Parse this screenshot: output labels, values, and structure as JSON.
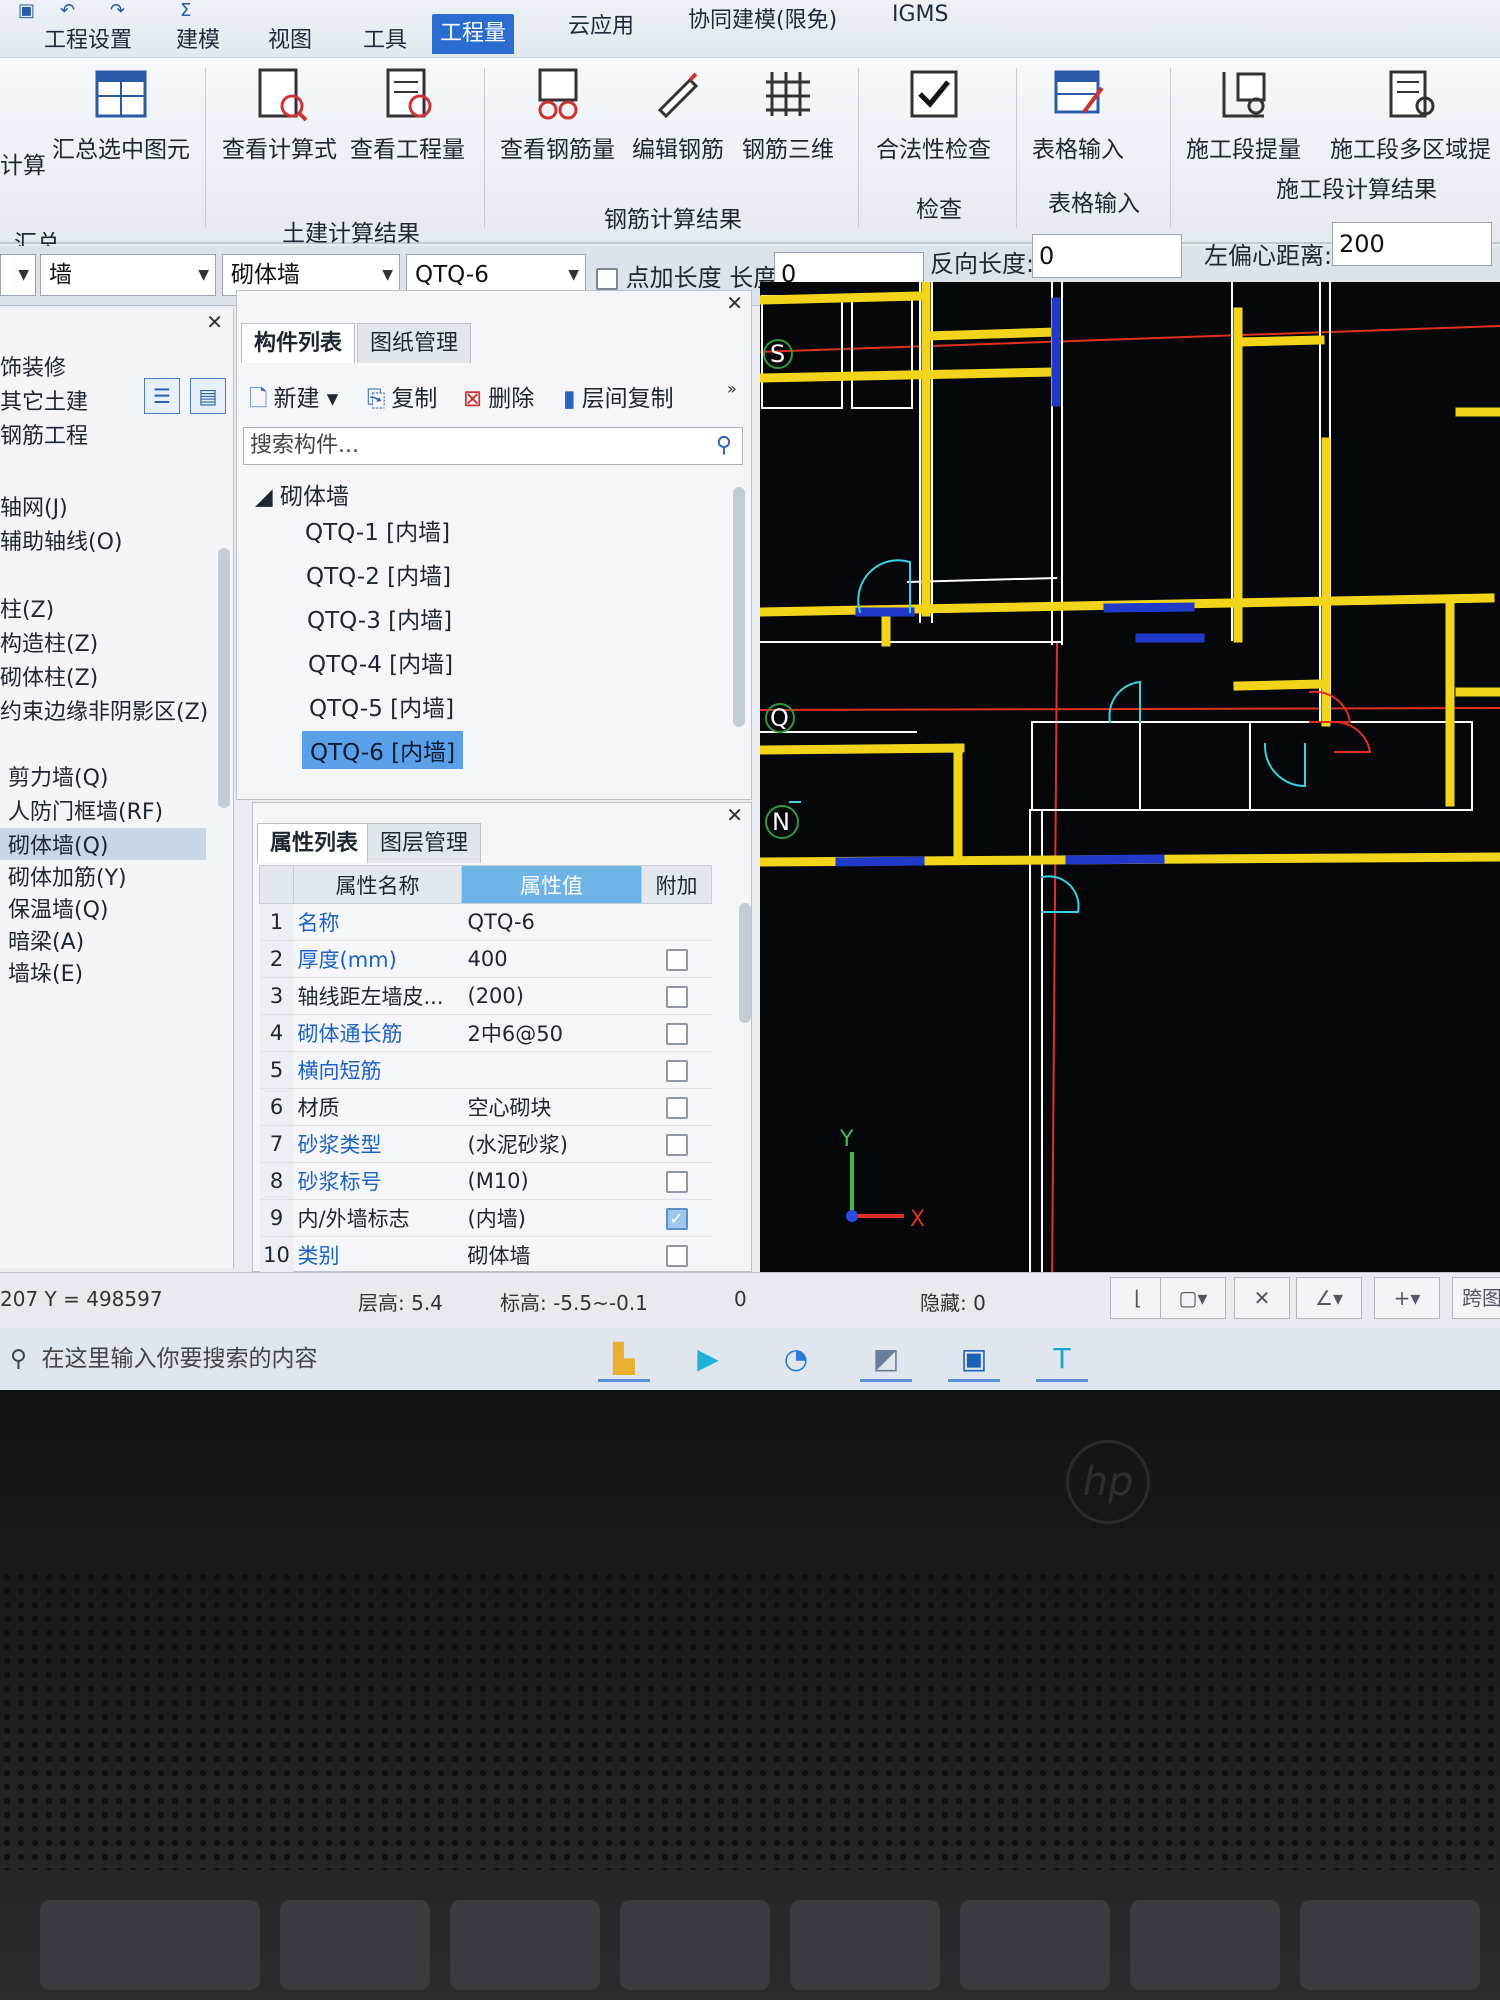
{
  "menu": {
    "tabs": [
      "工程设置",
      "建模",
      "视图",
      "工具",
      "工程量",
      "云应用",
      "协同建模(限免)",
      "IGMS"
    ],
    "active_tab": "工程量"
  },
  "ribbon": {
    "buttons": {
      "calc": "计算",
      "sum_selected": "汇总选中图元",
      "view_formula": "查看计算式",
      "view_quantity": "查看工程量",
      "view_rebar": "查看钢筋量",
      "edit_rebar": "编辑钢筋",
      "rebar_3d": "钢筋三维",
      "validity_check": "合法性检查",
      "table_input": "表格输入",
      "stage_extract": "施工段提量",
      "stage_multi": "施工段多区域提"
    },
    "groups": {
      "summary": "汇总",
      "civil_result": "土建计算结果",
      "rebar_result": "钢筋计算结果",
      "check": "检查",
      "table_input": "表格输入",
      "stage_result": "施工段计算结果"
    }
  },
  "selectors": {
    "floor": "",
    "category": "墙",
    "type": "砌体墙",
    "component": "QTQ-6",
    "add_length_label": "点加长度",
    "length_label": "长度:",
    "length_value": "0",
    "reverse_length_label": "反向长度:",
    "reverse_length_value": "0",
    "left_offset_label": "左偏心距离:",
    "left_offset_value": "200"
  },
  "leftnav": {
    "items": [
      "饰装修",
      "其它土建",
      "钢筋工程",
      "轴网(J)",
      "辅助轴线(O)",
      "柱(Z)",
      "构造柱(Z)",
      "砌体柱(Z)",
      "约束边缘非阴影区(Z)",
      "剪力墙(Q)",
      "人防门框墙(RF)",
      "砌体墙(Q)",
      "砌体加筋(Y)",
      "保温墙(Q)",
      "暗梁(A)",
      "墙垛(E)"
    ],
    "selected": "砌体墙(Q)"
  },
  "component_panel": {
    "tabs": [
      "构件列表",
      "图纸管理"
    ],
    "toolbar": {
      "new": "新建",
      "copy": "复制",
      "delete": "删除",
      "floor_copy": "层间复制"
    },
    "search_placeholder": "搜索构件...",
    "group": "砌体墙",
    "items": [
      "QTQ-1 [内墙]",
      "QTQ-2 [内墙]",
      "QTQ-3 [内墙]",
      "QTQ-4 [内墙]",
      "QTQ-5 [内墙]",
      "QTQ-6 [内墙]"
    ],
    "selected": "QTQ-6 [内墙]"
  },
  "properties": {
    "tabs": [
      "属性列表",
      "图层管理"
    ],
    "headers": [
      "属性名称",
      "属性值",
      "附加"
    ],
    "rows": [
      {
        "idx": "1",
        "name": "名称",
        "value": "QTQ-6",
        "blue": true,
        "check": null
      },
      {
        "idx": "2",
        "name": "厚度(mm)",
        "value": "400",
        "blue": true,
        "check": false
      },
      {
        "idx": "3",
        "name": "轴线距左墙皮...",
        "value": "(200)",
        "blue": false,
        "check": false
      },
      {
        "idx": "4",
        "name": "砌体通长筋",
        "value": "2中6@50",
        "blue": true,
        "check": false
      },
      {
        "idx": "5",
        "name": "横向短筋",
        "value": "",
        "blue": true,
        "check": false
      },
      {
        "idx": "6",
        "name": "材质",
        "value": "空心砌块",
        "blue": false,
        "check": false
      },
      {
        "idx": "7",
        "name": "砂浆类型",
        "value": "(水泥砂浆)",
        "blue": true,
        "check": false
      },
      {
        "idx": "8",
        "name": "砂浆标号",
        "value": "(M10)",
        "blue": true,
        "check": false
      },
      {
        "idx": "9",
        "name": "内/外墙标志",
        "value": "(内墙)",
        "blue": false,
        "check": true
      },
      {
        "idx": "10",
        "name": "类别",
        "value": "砌体墙",
        "blue": true,
        "check": false
      }
    ]
  },
  "drawing": {
    "axis_labels": [
      "S",
      "Q",
      "N"
    ],
    "x_axis": "X",
    "y_axis": "Y"
  },
  "status": {
    "coords": "207 Y = 498597",
    "floor_height": "层高:  5.4",
    "elevation": "标高:  -5.5~-0.1",
    "zero": "0",
    "hidden": "隐藏:  0",
    "cross": "跨图"
  },
  "taskbar": {
    "search_placeholder": "在这里输入你要搜索的内容"
  },
  "colors": {
    "ribbon_active": "#2b6cd0",
    "selection": "#5aa0e8",
    "wall_yellow": "#f2d51b",
    "wall_blue": "#2138c8",
    "axis_red": "#e0301e"
  }
}
